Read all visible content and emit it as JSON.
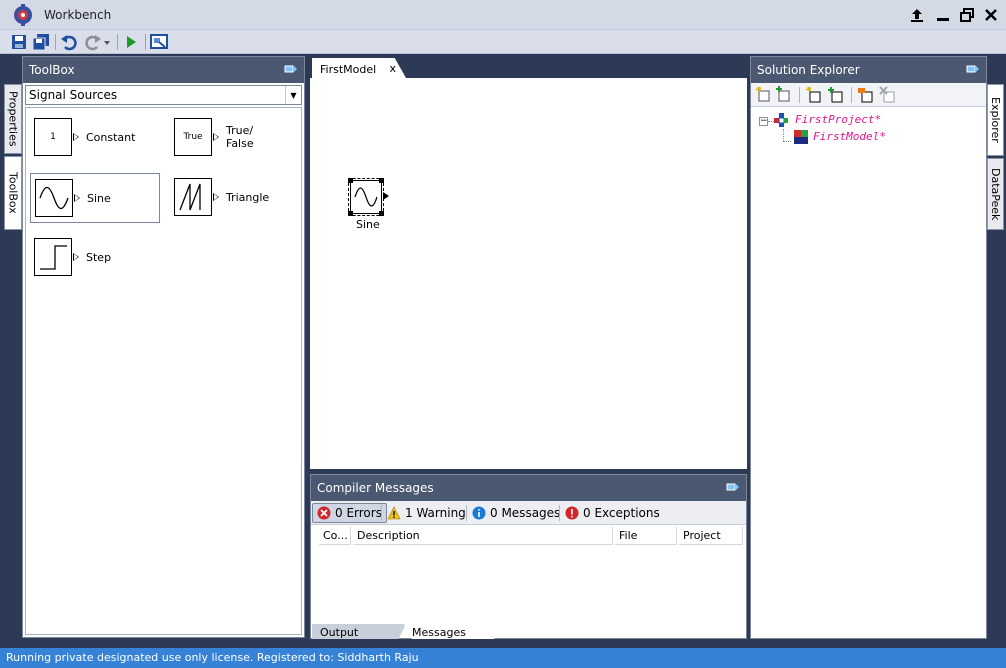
{
  "app": {
    "title": "Workbench"
  },
  "window_buttons": [
    "upload-icon",
    "minimize-icon",
    "restore-icon",
    "close-icon"
  ],
  "toolbar": {
    "icons": [
      "save-icon",
      "save-all-icon",
      "undo-icon",
      "redo-icon",
      "run-icon",
      "screenshot-icon"
    ]
  },
  "left_tabs": {
    "properties": "Properties",
    "toolbox": "ToolBox"
  },
  "right_tabs": {
    "explorer": "Explorer",
    "datapeek": "DataPeek"
  },
  "toolbox": {
    "title": "ToolBox",
    "category": "Signal Sources",
    "items": [
      {
        "label": "Constant",
        "glyph": "1"
      },
      {
        "label": "True/\nFalse",
        "glyph": "True"
      },
      {
        "label": "Sine"
      },
      {
        "label": "Triangle"
      },
      {
        "label": "Step"
      }
    ]
  },
  "document": {
    "tab_label": "FirstModel",
    "close_label": "x",
    "block_label": "Sine"
  },
  "compiler": {
    "title": "Compiler Messages",
    "errors": "0 Errors",
    "warnings": "1 Warning",
    "messages": "0 Messages",
    "exceptions": "0 Exceptions",
    "columns": [
      "Co...",
      "Description",
      "File",
      "Project"
    ],
    "tabs": {
      "output": "Output",
      "messages": "Messages"
    }
  },
  "solution_explorer": {
    "title": "Solution Explorer",
    "project": "FirstProject*",
    "model": "FirstModel*"
  },
  "status": {
    "text": "Running private designated use only license. Registered to: Siddharth Raju"
  },
  "colors": {
    "header": "#4a5872",
    "status": "#3582d6",
    "tree_text": "#e0168c"
  }
}
